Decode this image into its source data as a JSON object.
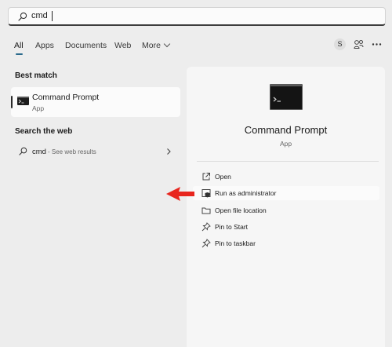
{
  "search": {
    "value": "cmd"
  },
  "tabs": [
    {
      "label": "All",
      "active": true
    },
    {
      "label": "Apps"
    },
    {
      "label": "Documents"
    },
    {
      "label": "Web"
    },
    {
      "label": "More"
    }
  ],
  "header": {
    "avatar_letter": "S"
  },
  "best_match": {
    "title": "Best match",
    "name": "Command Prompt",
    "type": "App"
  },
  "web": {
    "title": "Search the web",
    "query": "cmd",
    "suffix": "- See web results"
  },
  "detail": {
    "name": "Command Prompt",
    "type": "App",
    "actions": [
      {
        "label": "Open",
        "icon": "open-external-icon"
      },
      {
        "label": "Run as administrator",
        "icon": "shield-icon"
      },
      {
        "label": "Open file location",
        "icon": "folder-icon"
      },
      {
        "label": "Pin to Start",
        "icon": "pin-icon"
      },
      {
        "label": "Pin to taskbar",
        "icon": "pin-icon"
      }
    ]
  },
  "colors": {
    "accent": "#2b6a8c",
    "annotation_arrow": "#e8261e",
    "panel_bg": "#f6f6f6",
    "page_bg": "#ededed"
  }
}
